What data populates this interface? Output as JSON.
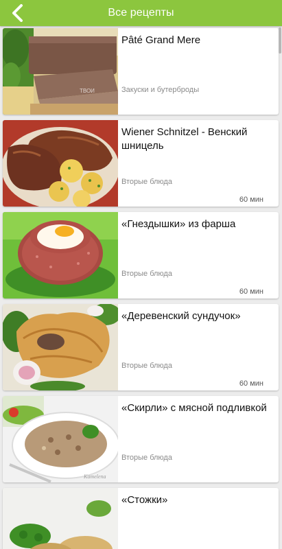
{
  "app_bar": {
    "title": "Все рецепты",
    "back_icon": "chevron-left-icon",
    "background": "#8cc63e"
  },
  "recipes": [
    {
      "title": "Pâté Grand Mere",
      "category": "Закуски и бутерброды",
      "time": "",
      "image_watermark": "ТВОИ"
    },
    {
      "title": "Wiener Schnitzel - Венский шницель",
      "category": "Вторые блюда",
      "time": "60 мин"
    },
    {
      "title": "«Гнездышки» из фарша",
      "category": "Вторые блюда",
      "time": "60 мин"
    },
    {
      "title": "«Деревенский сундучок»",
      "category": "Вторые блюда",
      "time": "60 мин"
    },
    {
      "title": "«Скирли» с мясной подливкой",
      "category": "Вторые блюда",
      "time": "",
      "image_watermark": "Kamelena"
    },
    {
      "title": "«Стожки»",
      "category": "",
      "time": ""
    }
  ]
}
